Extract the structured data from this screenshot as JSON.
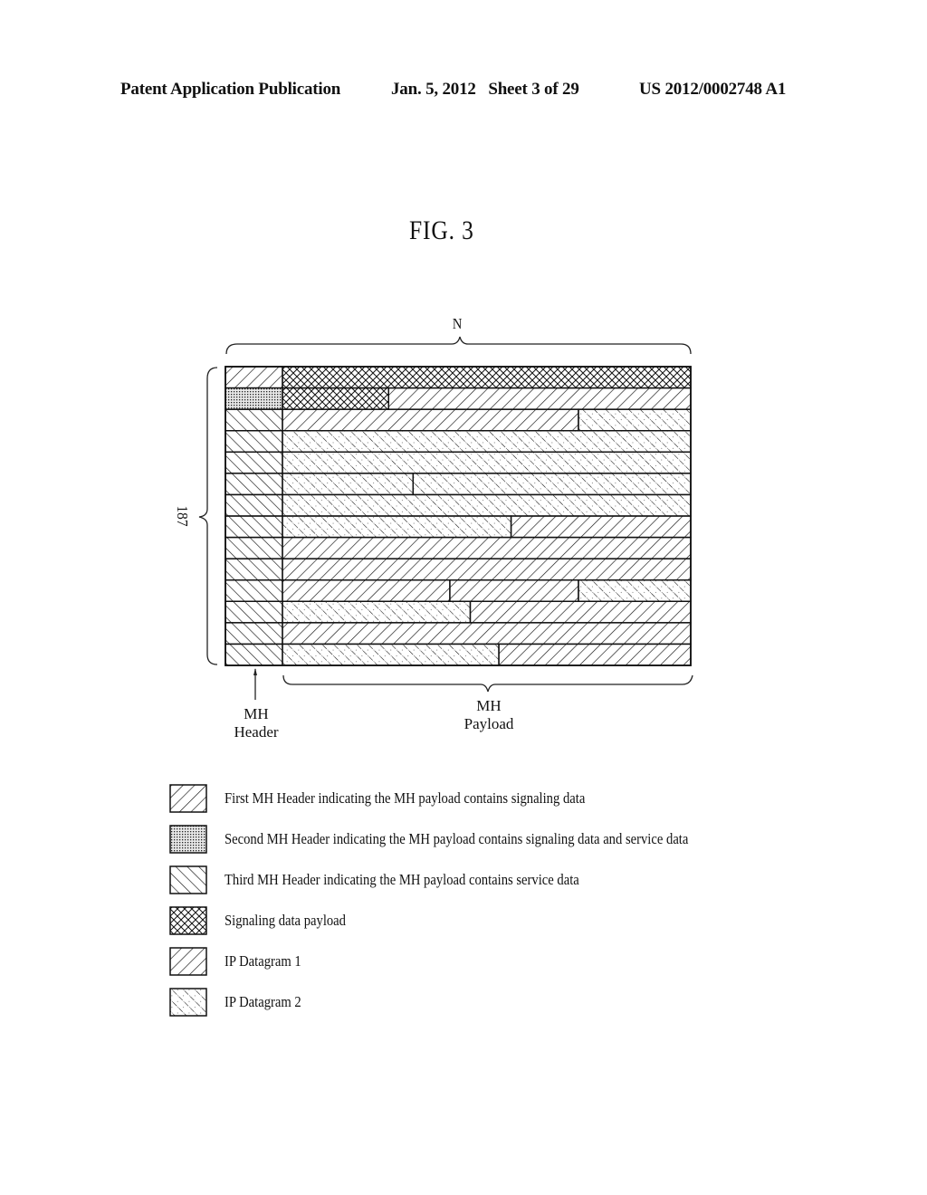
{
  "header": {
    "publication_type": "Patent Application Publication",
    "date": "Jan. 5, 2012",
    "sheet": "Sheet 3 of 29",
    "publication_number": "US 2012/0002748 A1"
  },
  "figure": {
    "title": "FIG. 3",
    "width_label": "N",
    "rows_label": "187",
    "header_column_label": "MH Header",
    "header_column_label_lines": [
      "MH",
      "Header"
    ],
    "payload_label": "MH Payload",
    "payload_label_lines": [
      "MH",
      "Payload"
    ]
  },
  "patterns": {
    "first_header": "First MH Header indicating the MH payload contains signaling data",
    "second_header": "Second MH Header indicating the MH payload contains signaling data and service data",
    "third_header": "Third MH Header indicating the MH payload contains service data",
    "signaling": "Signaling data payload",
    "ip1": "IP Datagram 1",
    "ip2": "IP Datagram 2"
  },
  "legend": [
    {
      "pattern": "first_header",
      "label": "First MH Header indicating the MH payload contains signaling data"
    },
    {
      "pattern": "second_header",
      "label": "Second MH Header indicating the MH payload contains signaling data and service data"
    },
    {
      "pattern": "third_header",
      "label": "Third MH Header indicating the MH payload contains service data"
    },
    {
      "pattern": "signaling",
      "label": "Signaling data payload"
    },
    {
      "pattern": "ip1",
      "label": "IP Datagram 1"
    },
    {
      "pattern": "ip2",
      "label": "IP Datagram 2"
    }
  ],
  "rows": [
    {
      "header": "first_header",
      "segments": [
        {
          "type": "signaling",
          "fraction": 1.0
        }
      ]
    },
    {
      "header": "second_header",
      "segments": [
        {
          "type": "signaling",
          "fraction": 0.26
        },
        {
          "type": "ip1",
          "fraction": 0.74
        }
      ]
    },
    {
      "header": "third_header",
      "segments": [
        {
          "type": "ip1",
          "fraction": 0.725
        },
        {
          "type": "ip2",
          "fraction": 0.275
        }
      ]
    },
    {
      "header": "third_header",
      "segments": [
        {
          "type": "ip2",
          "fraction": 1.0
        }
      ]
    },
    {
      "header": "third_header",
      "segments": [
        {
          "type": "ip2",
          "fraction": 1.0
        }
      ]
    },
    {
      "header": "third_header",
      "segments": [
        {
          "type": "ip2",
          "fraction": 0.32
        },
        {
          "type": "ip2",
          "fraction": 0.68
        }
      ]
    },
    {
      "header": "third_header",
      "segments": [
        {
          "type": "ip2",
          "fraction": 1.0
        }
      ]
    },
    {
      "header": "third_header",
      "segments": [
        {
          "type": "ip2",
          "fraction": 0.56
        },
        {
          "type": "ip1",
          "fraction": 0.44
        }
      ]
    },
    {
      "header": "third_header",
      "segments": [
        {
          "type": "ip1",
          "fraction": 1.0
        }
      ]
    },
    {
      "header": "third_header",
      "segments": [
        {
          "type": "ip1",
          "fraction": 1.0
        }
      ]
    },
    {
      "header": "third_header",
      "segments": [
        {
          "type": "ip1",
          "fraction": 0.41
        },
        {
          "type": "ip1",
          "fraction": 0.315
        },
        {
          "type": "ip2",
          "fraction": 0.275
        }
      ]
    },
    {
      "header": "third_header",
      "segments": [
        {
          "type": "ip2",
          "fraction": 0.46
        },
        {
          "type": "ip1",
          "fraction": 0.54
        }
      ]
    },
    {
      "header": "third_header",
      "segments": [
        {
          "type": "ip1",
          "fraction": 1.0
        }
      ]
    },
    {
      "header": "third_header",
      "segments": [
        {
          "type": "ip2",
          "fraction": 0.53
        },
        {
          "type": "ip1",
          "fraction": 0.47
        }
      ]
    }
  ]
}
